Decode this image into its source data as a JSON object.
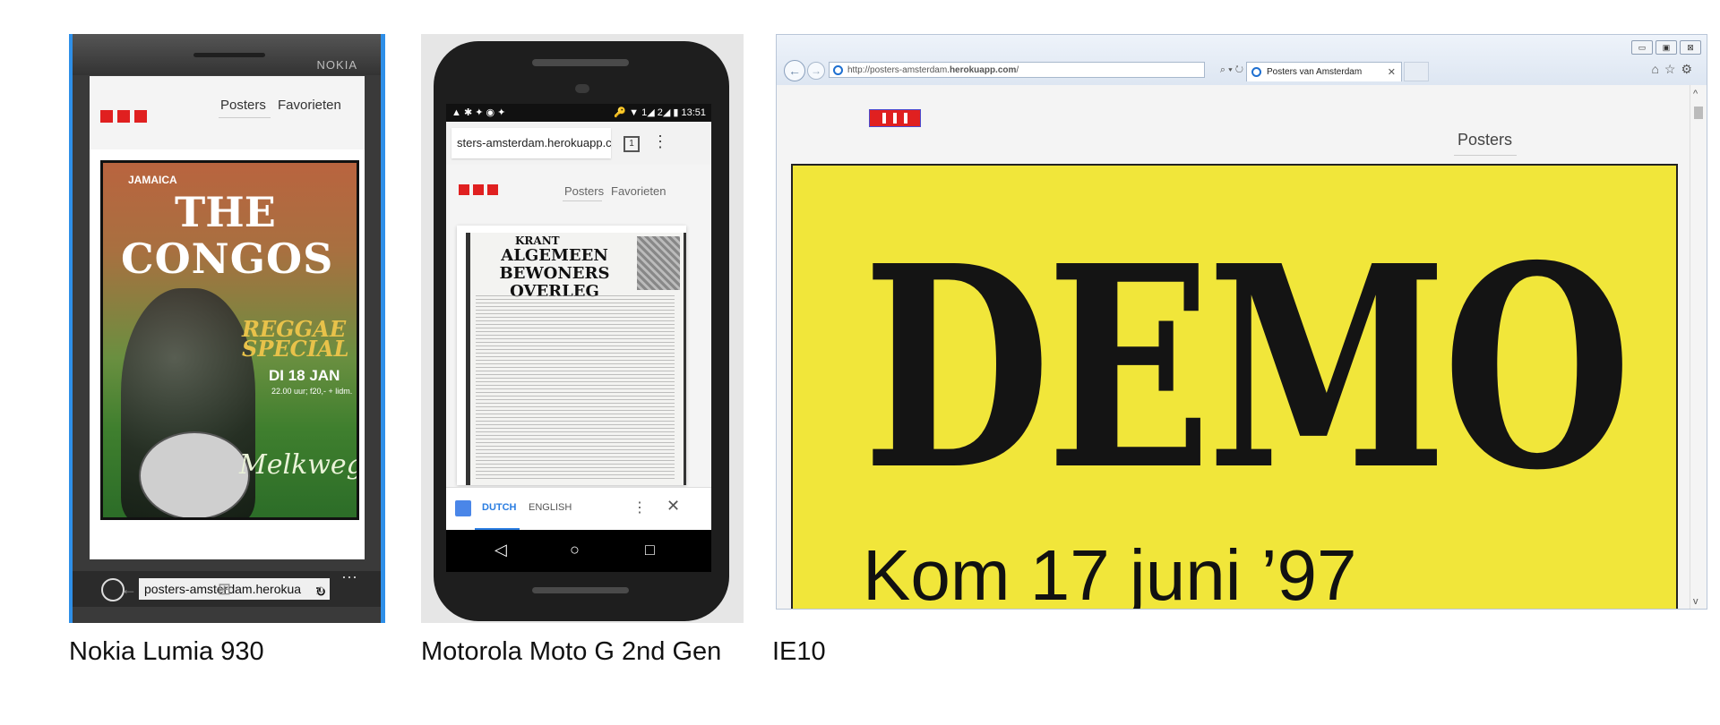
{
  "captions": {
    "nokia": "Nokia Lumia 930",
    "moto": "Motorola Moto G 2nd Gen",
    "ie": "IE10"
  },
  "colors": {
    "brand_red": "#e02020",
    "ie_accent": "#1e6fd0",
    "translate_blue": "#2a7de1",
    "demo_yellow": "#f1e63a"
  },
  "nokia": {
    "brand": "NOKIA",
    "nav": [
      "Posters",
      "Favorieten"
    ],
    "poster": {
      "top_left": "JAMAICA",
      "title_1": "THE",
      "title_2": "CONGOS",
      "subtitle_1": "REGGAE",
      "subtitle_2": "SPECIAL",
      "date": "DI 18 JAN",
      "price": "22.00 uur; f20,- + lidm.",
      "venue": "Melkweg"
    },
    "url": "posters-amsterdam.herokua",
    "tabs_icon": "tabs-icon",
    "reload_icon": "↻",
    "more": "···",
    "keys": [
      "←",
      "⊞",
      "⌕"
    ]
  },
  "moto": {
    "status_left": "▲ ✱ ✦ ◉ ✦",
    "status_right": "🔑 ▼ 1◢ 2◢ ▮ 13:51",
    "url": "sters-amsterdam.herokuapp.com",
    "tab_count": "1",
    "menu": "⋮",
    "nav": [
      "Posters",
      "Favorieten"
    ],
    "poster": {
      "masthead": "KRANT",
      "headline": "ALGEMEEN BEWONERS OVERLEG"
    },
    "translate": {
      "tab_active": "DUTCH",
      "tab_other": "ENGLISH",
      "more": "⋮",
      "close": "✕"
    },
    "navbar": [
      "◁",
      "○",
      "□"
    ]
  },
  "ie": {
    "address_prefix": "http://posters-amsterdam.",
    "address_domain": "herokuapp.com",
    "address_suffix": "/",
    "search_controls": "⌕ ▾ ↻",
    "tab_title": "Posters van Amsterdam",
    "tab_close": "✕",
    "win_buttons": [
      "▭",
      "▣",
      "⊠"
    ],
    "right_icons": "⌂☆⚙",
    "nav": "Posters",
    "poster": {
      "headline": "DEMO",
      "line2": "Kom 17 juni ’97"
    },
    "scroll_up": "^",
    "scroll_down": "v"
  }
}
